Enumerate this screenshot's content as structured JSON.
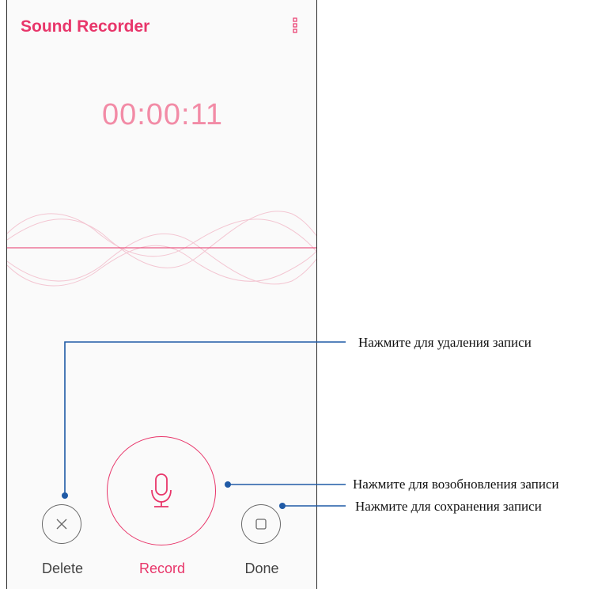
{
  "app": {
    "title": "Sound Recorder",
    "accent_color": "#e8366a",
    "menu_icon": "more-vert-icon"
  },
  "recorder": {
    "elapsed_time": "00:00:11",
    "timer_color": "#f28ba6"
  },
  "controls": {
    "delete": {
      "label": "Delete",
      "icon": "close-icon"
    },
    "record": {
      "label": "Record",
      "icon": "microphone-icon"
    },
    "done": {
      "label": "Done",
      "icon": "stop-square-icon"
    }
  },
  "callouts": {
    "delete": "Нажмите для удаления записи",
    "record": "Нажмите для возобновления записи",
    "done": "Нажмите для сохранения записи",
    "line_color": "#1f5aa6"
  }
}
